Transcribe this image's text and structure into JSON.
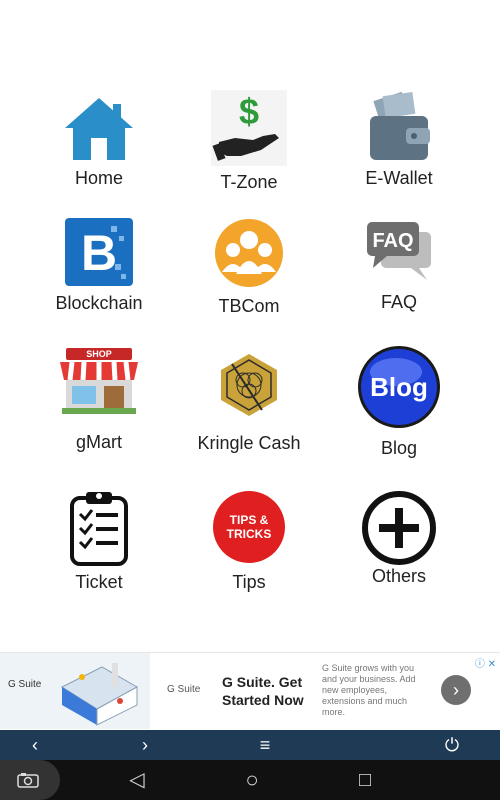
{
  "menu": [
    {
      "label": "Home",
      "icon": "home-icon"
    },
    {
      "label": "T-Zone",
      "icon": "money-hand-icon"
    },
    {
      "label": "E-Wallet",
      "icon": "wallet-icon"
    },
    {
      "label": "Blockchain",
      "icon": "blockchain-icon"
    },
    {
      "label": "TBCom",
      "icon": "community-icon"
    },
    {
      "label": "FAQ",
      "icon": "faq-icon"
    },
    {
      "label": "gMart",
      "icon": "shop-icon"
    },
    {
      "label": "Kringle Cash",
      "icon": "kringle-cash-icon"
    },
    {
      "label": "Blog",
      "icon": "blog-icon"
    },
    {
      "label": "Ticket",
      "icon": "ticket-clipboard-icon"
    },
    {
      "label": "Tips",
      "icon": "tips-icon"
    },
    {
      "label": "Others",
      "icon": "plus-circle-icon"
    }
  ],
  "icon_text": {
    "faq": "FAQ",
    "blog": "Blog",
    "tips_line1": "TIPS &",
    "tips_line2": "TRICKS",
    "shop": "SHOP"
  },
  "ad": {
    "thumb_brand": "G Suite",
    "brand": "G Suite",
    "headline": "G Suite. Get Started Now",
    "description": "G Suite grows with you and your business. Add new employees, extensions and much more.",
    "ad_badge": "ⓘ ✕"
  },
  "appbar": {
    "back": "‹",
    "forward": "›",
    "menu": "≡",
    "power": "⏻"
  },
  "navbar": {
    "back": "◁",
    "home": "○",
    "recents": "□"
  },
  "colors": {
    "appbar": "#1f3a55",
    "navbar": "#111111",
    "home_blue": "#2a8fc9",
    "blockchain_blue": "#1b6fc0",
    "tbcom_orange": "#f2a42b",
    "tips_red": "#e02020"
  }
}
